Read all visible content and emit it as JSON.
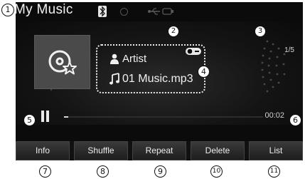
{
  "header": {
    "title": "My Music"
  },
  "nowplaying": {
    "artist": "Artist",
    "filename": "01 Music.mp3",
    "track_counter": "1/5",
    "elapsed_time": "00:02",
    "progress_fraction": 0.02
  },
  "buttons": {
    "info": "Info",
    "shuffle": "Shuffle",
    "repeat": "Repeat",
    "delete": "Delete",
    "list": "List"
  },
  "callouts": [
    "1",
    "2",
    "3",
    "4",
    "5",
    "6",
    "7",
    "8",
    "9",
    "10",
    "11"
  ]
}
